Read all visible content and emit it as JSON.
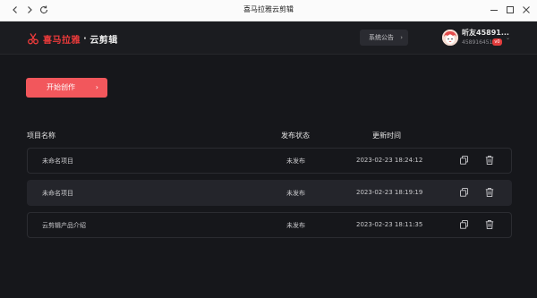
{
  "window": {
    "title": "喜马拉雅云剪辑"
  },
  "header": {
    "brand": "喜马拉雅",
    "separator": "·",
    "product": "云剪辑",
    "notice_label": "系统公告",
    "notice_chevron": "›",
    "user_name": "听友45891...",
    "user_id": "458916451",
    "user_badge": "v0",
    "user_chevron": "⌄"
  },
  "main": {
    "start_label": "开始创作",
    "start_chevron": "›",
    "columns": {
      "name": "项目名称",
      "status": "发布状态",
      "updated": "更新时间"
    },
    "rows": [
      {
        "name": "未命名项目",
        "status": "未发布",
        "updated": "2023-02-23 18:24:12"
      },
      {
        "name": "未命名项目",
        "status": "未发布",
        "updated": "2023-02-23 18:19:19"
      },
      {
        "name": "云剪辑产品介绍",
        "status": "未发布",
        "updated": "2023-02-23 18:11:35"
      }
    ]
  },
  "colors": {
    "accent": "#f2575c",
    "brand": "#ef3b3b",
    "background": "#16171b"
  }
}
